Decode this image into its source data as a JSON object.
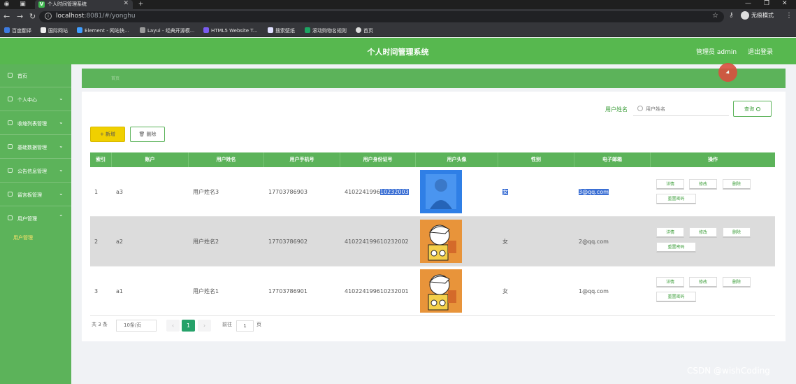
{
  "browser": {
    "tab_title": "个人时间管理系统",
    "url_host": "localhost",
    "url_rest": ":8081/#/yonghu",
    "incognito_label": "无痕模式",
    "bookmarks": [
      "百度翻译",
      "国际网站",
      "Element - 网站快...",
      "Layui - 经典开源模...",
      "HTML5 Website T...",
      "搜索壁纸",
      "滚动购物名规则",
      "首页"
    ]
  },
  "header": {
    "title": "个人时间管理系统",
    "admin": "管理员 admin",
    "logout": "退出登录"
  },
  "sidebar": {
    "items": [
      {
        "label": "首页"
      },
      {
        "label": "个人中心"
      },
      {
        "label": "收缩列表管理"
      },
      {
        "label": "基础数据管理"
      },
      {
        "label": "公告信息管理"
      },
      {
        "label": "留言板管理"
      },
      {
        "label": "用户管理"
      }
    ],
    "sub_item": "用户管理"
  },
  "breadcrumb": {
    "text": "首页"
  },
  "search": {
    "label": "用户姓名",
    "placeholder": "用户姓名",
    "button": "查询"
  },
  "toolbar": {
    "add": "+ 新增",
    "delete": "删除"
  },
  "table": {
    "columns": [
      "索引",
      "账户",
      "用户姓名",
      "用户手机号",
      "用户身份证号",
      "用户头像",
      "性别",
      "电子邮箱",
      "操作"
    ],
    "rows": [
      {
        "index": "1",
        "account": "a3",
        "name": "用户姓名3",
        "phone": "17703786903",
        "idcard_pre": "4102241996",
        "idcard_hl": "10232003",
        "gender": "女",
        "email": "3@qq.com",
        "avatar": "blue"
      },
      {
        "index": "2",
        "account": "a2",
        "name": "用户姓名2",
        "phone": "17703786902",
        "idcard_pre": "410224199610232002",
        "idcard_hl": "",
        "gender": "女",
        "email": "2@qq.com",
        "avatar": "cartoon"
      },
      {
        "index": "3",
        "account": "a1",
        "name": "用户姓名1",
        "phone": "17703786901",
        "idcard_pre": "410224199610232001",
        "idcard_hl": "",
        "gender": "女",
        "email": "1@qq.com",
        "avatar": "cartoon"
      }
    ],
    "actions": {
      "detail": "详情",
      "edit": "修改",
      "delete": "删除",
      "reset": "重置密码"
    }
  },
  "pagination": {
    "total": "共 3 条",
    "page_size": "10条/页",
    "current": "1",
    "goto_label": "前往",
    "goto_value": "1",
    "page_unit": "页"
  },
  "watermark": "CSDN @wishCoding"
}
